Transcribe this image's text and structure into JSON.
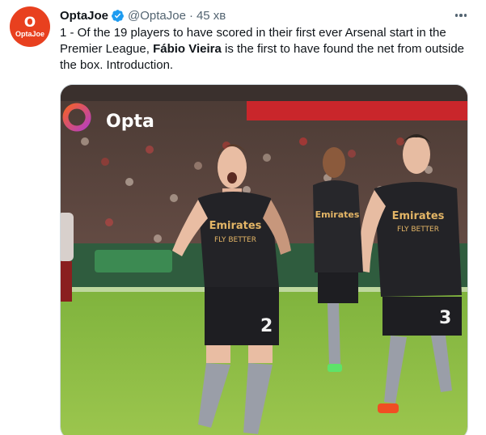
{
  "author": {
    "avatar_glyph": "O",
    "avatar_text": "OptaJoe",
    "name": "OptaJoe",
    "handle": "@OptaJoe",
    "separator": "·",
    "time": "45 хв"
  },
  "tweet": {
    "text_part1": "1 - Of the 19 players to have scored in their first ever Arsenal start in the Premier League, ",
    "text_bold": "Fábio Vieira",
    "text_part2": " is the first to have found the net from outside the box. Introduction."
  },
  "media": {
    "watermark": "Opta",
    "sponsor_text": "Emirates",
    "sponsor_slogan": "FLY BETTER",
    "player_numbers": [
      "2",
      "3"
    ]
  },
  "colors": {
    "avatar_bg": "#e8401f",
    "verified": "#1d9bf0",
    "pitch": "#8fbf45",
    "kit": "#232327"
  }
}
